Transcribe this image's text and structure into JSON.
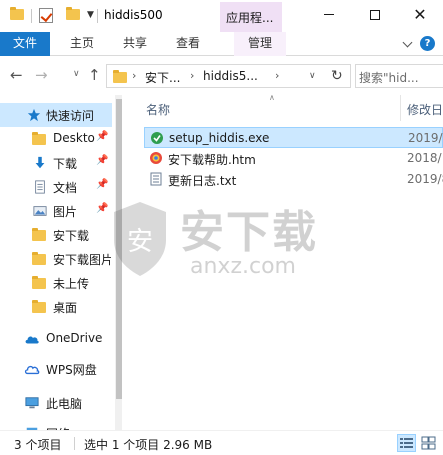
{
  "window": {
    "title": "hiddis500",
    "context_tab_group": "应用程..."
  },
  "ribbon": {
    "file_tab": "文件",
    "tabs": [
      "主页",
      "共享",
      "查看"
    ],
    "context_tab": "管理",
    "help": "?"
  },
  "address": {
    "crumbs": [
      "安下...",
      "hiddis5..."
    ],
    "search_placeholder": "搜索\"hid..."
  },
  "sidebar": {
    "items": [
      {
        "label": "快速访问",
        "icon": "quick-access-star-icon",
        "pinned": false
      },
      {
        "label": "Desktop",
        "icon": "folder-icon",
        "pinned": true
      },
      {
        "label": "下载",
        "icon": "download-arrow-icon",
        "pinned": true
      },
      {
        "label": "文档",
        "icon": "document-icon",
        "pinned": true
      },
      {
        "label": "图片",
        "icon": "picture-icon",
        "pinned": true
      },
      {
        "label": "安下载",
        "icon": "folder-icon",
        "pinned": false
      },
      {
        "label": "安下载图片",
        "icon": "folder-icon",
        "pinned": false
      },
      {
        "label": "未上传",
        "icon": "folder-icon",
        "pinned": false
      },
      {
        "label": "桌面",
        "icon": "folder-icon",
        "pinned": false
      },
      {
        "label": "OneDrive",
        "icon": "cloud-icon",
        "pinned": false
      },
      {
        "label": "WPS网盘",
        "icon": "wps-cloud-icon",
        "pinned": false
      },
      {
        "label": "此电脑",
        "icon": "computer-icon",
        "pinned": false
      },
      {
        "label": "网络",
        "icon": "network-icon",
        "pinned": false
      }
    ]
  },
  "columns": {
    "name": "名称",
    "modified": "修改日"
  },
  "files": [
    {
      "name": "setup_hiddis.exe",
      "date": "2019/",
      "icon": "setup-exe-icon",
      "selected": true
    },
    {
      "name": "安下载帮助.htm",
      "date": "2018/",
      "icon": "htm-file-icon",
      "selected": false
    },
    {
      "name": "更新日志.txt",
      "date": "2019/8",
      "icon": "text-file-icon",
      "selected": false
    }
  ],
  "watermark": {
    "brand": "安下载",
    "domain": "anxz.com",
    "shield_char": "安"
  },
  "status": {
    "count": "3 个项目",
    "selected": "选中 1 个项目  2.96 MB"
  },
  "colors": {
    "accent": "#1979ca",
    "selection": "#cce8ff",
    "context_tab": "#f0e0f5",
    "folder": "#f4c44e"
  }
}
